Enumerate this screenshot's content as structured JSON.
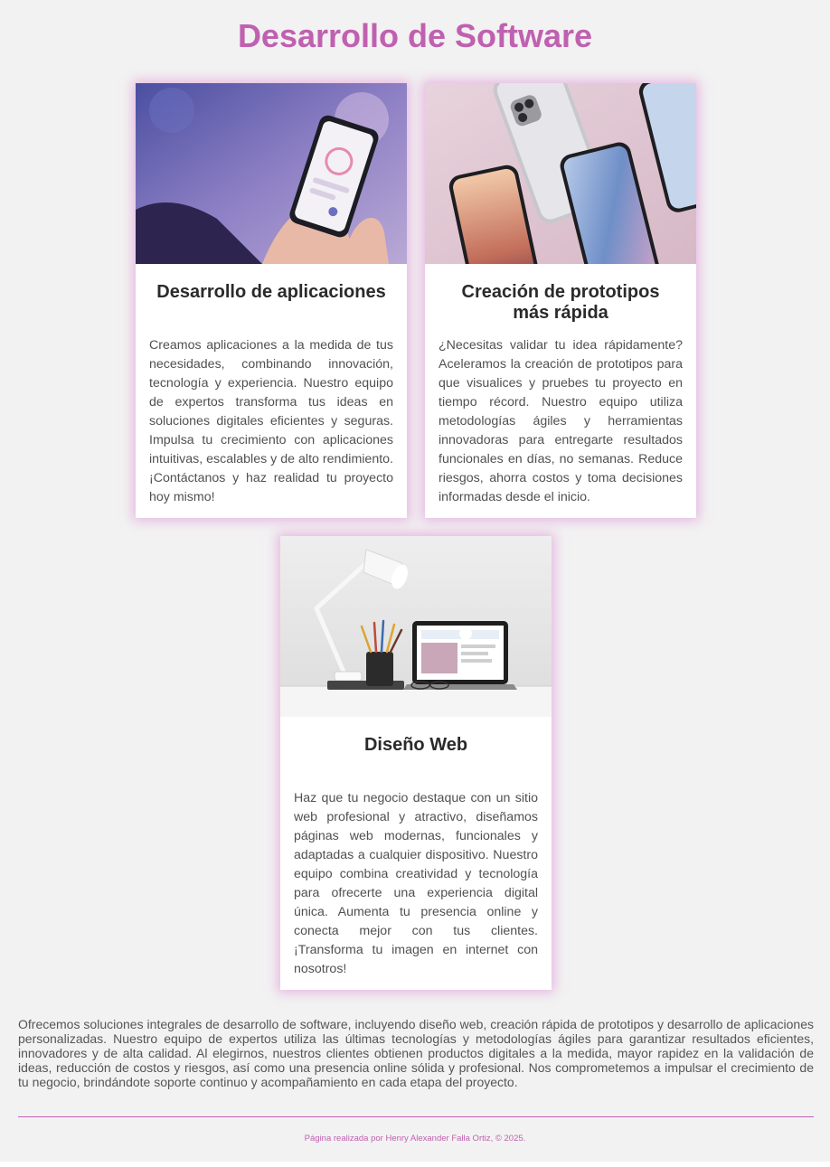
{
  "page": {
    "title": "Desarrollo de Software"
  },
  "cards": [
    {
      "image_desc": "hand-holding-phone-app",
      "title": "Desarrollo de aplicaciones",
      "text": "Creamos aplicaciones a la medida de tus necesidades, combinando innovación, tecnología y experiencia. Nuestro equipo de expertos transforma tus ideas en soluciones digitales eficientes y seguras. Impulsa tu crecimiento con aplicaciones intuitivas, escalables y de alto rendimiento. ¡Contáctanos y haz realidad tu proyecto hoy mismo!"
    },
    {
      "image_desc": "iphone-mockups",
      "title": "Creación de prototipos más rápida",
      "text": "¿Necesitas validar tu idea rápidamente? Aceleramos la creación de prototipos para que visualices y pruebes tu proyecto en tiempo récord. Nuestro equipo utiliza metodologías ágiles y herramientas innovadoras para entregarte resultados funcionales en días, no semanas. Reduce riesgos, ahorra costos y toma decisiones informadas desde el inicio."
    },
    {
      "image_desc": "desk-lamp-laptop",
      "title": "Diseño Web",
      "text": "Haz que tu negocio destaque con un sitio web profesional y atractivo, diseñamos páginas web modernas, funcionales y adaptadas a cualquier dispositivo. Nuestro equipo combina creatividad y tecnología para ofrecerte una experiencia digital única. Aumenta tu presencia online y conecta mejor con tus clientes. ¡Transforma tu imagen en internet con nosotros!"
    }
  ],
  "intro": "Ofrecemos soluciones integrales de desarrollo de software, incluyendo diseño web, creación rápida de prototipos y desarrollo de aplicaciones personalizadas. Nuestro equipo de expertos utiliza las últimas tecnologías y metodologías ágiles para garantizar resultados eficientes, innovadores y de alta calidad. Al elegirnos, nuestros clientes obtienen productos digitales a la medida, mayor rapidez en la validación de ideas, reducción de costos y riesgos, así como una presencia online sólida y profesional. Nos comprometemos a impulsar el crecimiento de tu negocio, brindándote soporte continuo y acompañamiento en cada etapa del proyecto.",
  "footer": "Página realizada por Henry Alexander Falla Ortiz, © 2025.",
  "colors": {
    "accent": "#c060b0",
    "background": "#f2f2f2",
    "card": "#ffffff",
    "text": "#505050"
  }
}
